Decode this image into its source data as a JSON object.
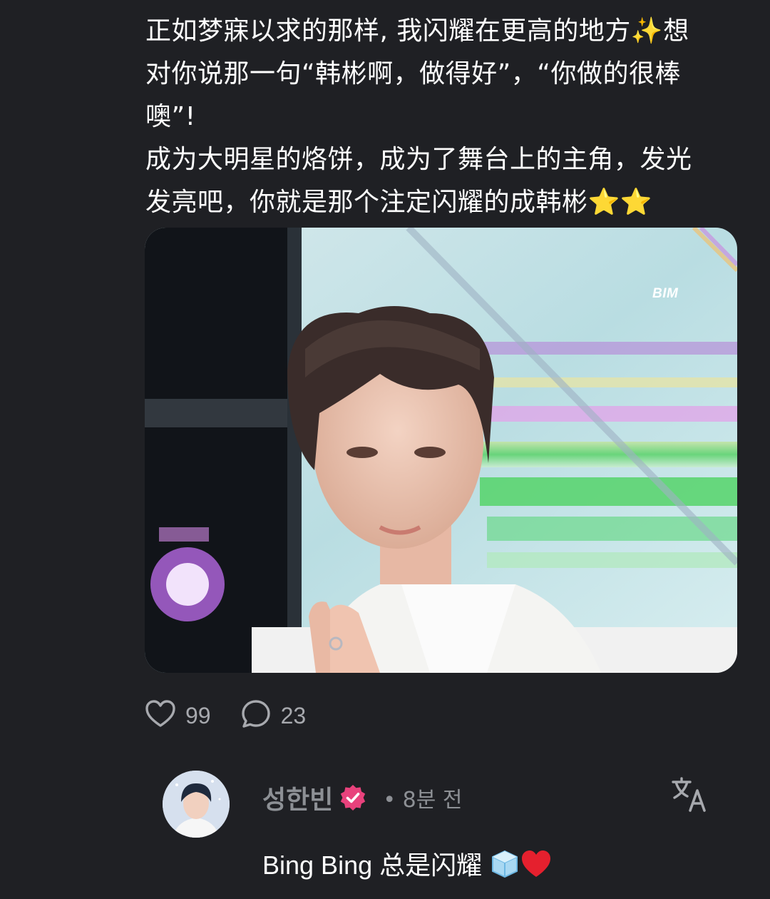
{
  "post": {
    "lines": [
      "正如梦寐以求的那样, 我闪耀在更高的地方✨想",
      "对你说那一句“韩彬啊，做得好”，“你做的很棒",
      "噢”!",
      "成为大明星的烙饼，成为了舞台上的主角，发光",
      "发亮吧，你就是那个注定闪耀的成韩彬⭐⭐"
    ],
    "image": {
      "watermark": "BIM"
    },
    "likes": "99",
    "comments": "23"
  },
  "reply": {
    "username": "성한빈",
    "time": "• 8분 전",
    "text": "Bing Bing 总是闪耀 ",
    "emoji_names": [
      "ice-cube-emoji",
      "red-heart-emoji"
    ]
  },
  "icons": {
    "like": "heart-outline-icon",
    "comment": "speech-bubble-icon",
    "verified": "verified-badge-icon",
    "translate": "translate-icon"
  },
  "colors": {
    "background": "#1f2024",
    "muted_text": "#8d9095",
    "verified_badge": "#e8427c"
  }
}
